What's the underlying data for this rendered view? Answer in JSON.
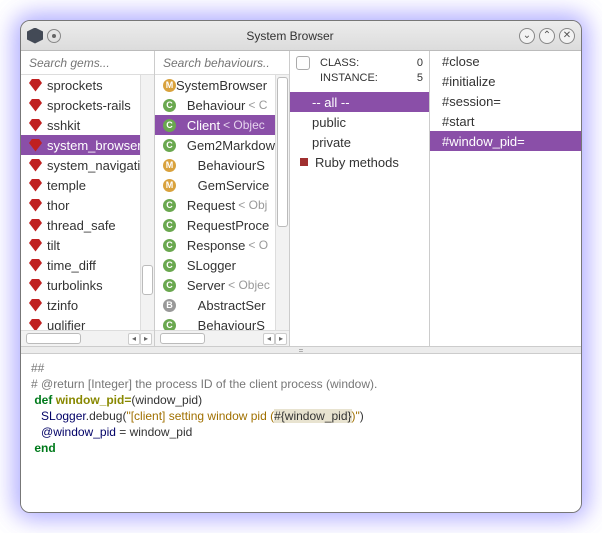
{
  "window": {
    "title": "System Browser"
  },
  "col1": {
    "placeholder": "Search gems...",
    "items": [
      {
        "label": "sprockets",
        "sel": false
      },
      {
        "label": "sprockets-rails",
        "sel": false
      },
      {
        "label": "sshkit",
        "sel": false
      },
      {
        "label": "system_browser",
        "sel": true
      },
      {
        "label": "system_navigatio",
        "sel": false
      },
      {
        "label": "temple",
        "sel": false
      },
      {
        "label": "thor",
        "sel": false
      },
      {
        "label": "thread_safe",
        "sel": false
      },
      {
        "label": "tilt",
        "sel": false
      },
      {
        "label": "time_diff",
        "sel": false
      },
      {
        "label": "turbolinks",
        "sel": false
      },
      {
        "label": "tzinfo",
        "sel": false
      },
      {
        "label": "uglifier",
        "sel": false
      }
    ]
  },
  "col2": {
    "placeholder": "Search behaviours..",
    "items": [
      {
        "kind": "M",
        "label": "SystemBrowser",
        "indent": 0,
        "suffix": "",
        "sel": false
      },
      {
        "kind": "C",
        "label": "Behaviour",
        "indent": 1,
        "suffix": "< C",
        "sel": false
      },
      {
        "kind": "C",
        "label": "Client",
        "indent": 1,
        "suffix": "< Objec",
        "sel": true
      },
      {
        "kind": "C",
        "label": "Gem2Markdow",
        "indent": 1,
        "suffix": "",
        "sel": false
      },
      {
        "kind": "M",
        "label": "BehaviourS",
        "indent": 2,
        "suffix": "",
        "sel": false
      },
      {
        "kind": "M",
        "label": "GemService",
        "indent": 2,
        "suffix": "",
        "sel": false
      },
      {
        "kind": "C",
        "label": "Request",
        "indent": 1,
        "suffix": "< Obj",
        "sel": false
      },
      {
        "kind": "C",
        "label": "RequestProce",
        "indent": 1,
        "suffix": "",
        "sel": false
      },
      {
        "kind": "C",
        "label": "Response",
        "indent": 1,
        "suffix": "< O",
        "sel": false
      },
      {
        "kind": "C",
        "label": "SLogger",
        "indent": 1,
        "suffix": "",
        "sel": false
      },
      {
        "kind": "C",
        "label": "Server",
        "indent": 1,
        "suffix": "< Objec",
        "sel": false
      },
      {
        "kind": "B",
        "label": "AbstractSer",
        "indent": 2,
        "suffix": "",
        "sel": false
      },
      {
        "kind": "C",
        "label": "BehaviourS",
        "indent": 2,
        "suffix": "",
        "sel": false
      }
    ]
  },
  "col3": {
    "stats": {
      "class_label": "CLASS:",
      "class_count": "0",
      "instance_label": "INSTANCE:",
      "instance_count": "5"
    },
    "filters": [
      {
        "label": "-- all --",
        "sel": true
      },
      {
        "label": "public",
        "sel": false
      },
      {
        "label": "private",
        "sel": false
      }
    ],
    "cat": "Ruby methods"
  },
  "col4": {
    "methods": [
      {
        "label": "#close",
        "sel": false
      },
      {
        "label": "#initialize",
        "sel": false
      },
      {
        "label": "#session=",
        "sel": false
      },
      {
        "label": "#start",
        "sel": false
      },
      {
        "label": "#window_pid=",
        "sel": true
      }
    ]
  },
  "code": {
    "l1": "##",
    "l2": "# @return [Integer] the process ID of the client process (window).",
    "l3a": "def",
    "l3b": "window_pid=",
    "l3c": "(window_pid)",
    "l4a": "SLogger",
    "l4b": ".debug(",
    "l4c": "\"[client] setting window pid (",
    "l4d": "#{",
    "l4e": "window_pid",
    "l4f": "}",
    "l4g": ")\"",
    "l4h": ")",
    "l5a": "@window_pid",
    "l5b": " = window_pid",
    "l6": "end"
  }
}
